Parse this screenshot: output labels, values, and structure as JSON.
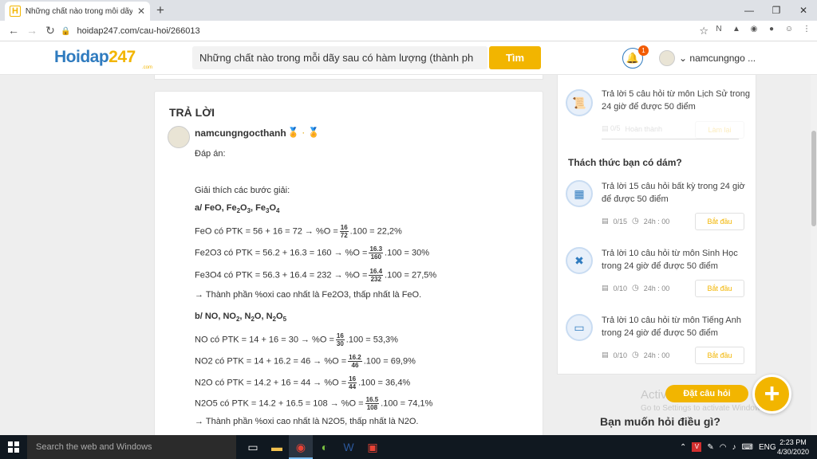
{
  "browser": {
    "tab_title": "Những chất nào trong mỗi dãy s",
    "favicon_letter": "H",
    "url": "hoidap247.com/cau-hoi/266013",
    "new_tab": "+",
    "win_min": "—",
    "win_max": "❐",
    "win_close": "✕"
  },
  "header": {
    "logo_prefix": "Hoidap",
    "logo_num": "247",
    "logo_com": ".com",
    "search_value": "Những chất nào trong mỗi dãy sau có hàm lượng (thành ph",
    "search_button": "Tìm",
    "notification_count": "1",
    "username": "namcungngo ..."
  },
  "answer": {
    "heading": "TRẢ LỜI",
    "username": "namcungngocthanh",
    "medals": "🏅 · 🏅",
    "intro": "Đáp án:",
    "explain": "Giải thích các bước giải:",
    "part_a_title": "a/ FeO, Fe2O3, Fe3O4",
    "part_a": [
      {
        "pre": "FeO có PTK = 56 + 16 = 72 → %O =",
        "num": "16",
        "den": "72",
        "post": ".100 = 22,2%"
      },
      {
        "pre": "Fe2O3 có PTK = 56.2 + 16.3 = 160 → %O =",
        "num": "16.3",
        "den": "160",
        "post": ".100 = 30%"
      },
      {
        "pre": "Fe3O4 có PTK = 56.3 + 16.4 = 232 → %O =",
        "num": "16.4",
        "den": "232",
        "post": ".100 = 27,5%"
      }
    ],
    "part_a_conclusion": "→ Thành phần %oxi cao nhất là Fe2O3, thấp nhất là FeO.",
    "part_b_title": "b/ NO, NO2, N2O, N2O5",
    "part_b": [
      {
        "pre": "NO có PTK = 14 + 16 = 30 → %O =",
        "num": "16",
        "den": "30",
        "post": ".100 = 53,3%"
      },
      {
        "pre": "NO2 có PTK = 14 + 16.2 = 46 → %O =",
        "num": "16.2",
        "den": "46",
        "post": ".100 = 69,9%"
      },
      {
        "pre": "N2O có PTK = 14.2 + 16 = 44 → %O =",
        "num": "16",
        "den": "44",
        "post": ".100 = 36,4%"
      },
      {
        "pre": "N2O5 có PTK = 14.2 + 16.5 = 108 → %O =",
        "num": "16.5",
        "den": "108",
        "post": ".100 = 74,1%"
      }
    ],
    "part_b_conclusion": "→ Thành phần %oxi cao nhất là N2O5, thấp nhất là N2O."
  },
  "sidebar": {
    "top_task": {
      "text": "Trả lời 5 câu hỏi  từ môn Lịch Sử trong 24 giờ để được 50 điểm",
      "icon": "scroll-icon"
    },
    "challenge_title": "Thách thức bạn có dám?",
    "tasks": [
      {
        "text": "Trả lời 15 câu hỏi  bất kỳ  trong 24 giờ để được 50 điểm",
        "progress": "0/15",
        "time": "24h : 00",
        "button": "Bắt đầu",
        "icon": "grid-icon"
      },
      {
        "text": "Trả lời 10 câu hỏi  từ môn Sinh Học trong 24 giờ để được 50 điểm",
        "progress": "0/10",
        "time": "24h : 00",
        "button": "Bắt đầu",
        "icon": "dna-icon"
      },
      {
        "text": "Trả lời 10 câu hỏi  từ môn Tiếng Anh trong 24 giờ để được 50 điểm",
        "progress": "0/10",
        "time": "24h : 00",
        "button": "Bắt đầu",
        "icon": "english-icon"
      }
    ],
    "ask_pill": "Đặt câu hỏi",
    "ask_fab": "+",
    "want_ask": "Bạn muốn hỏi điều gì?",
    "activate_title": "Activ",
    "activate_sub": "Go to Settings to activate Windows."
  },
  "taskbar": {
    "search_placeholder": "Search the web and Windows",
    "tray_lang": "ENG",
    "time": "2:23 PM",
    "date": "4/30/2020"
  }
}
